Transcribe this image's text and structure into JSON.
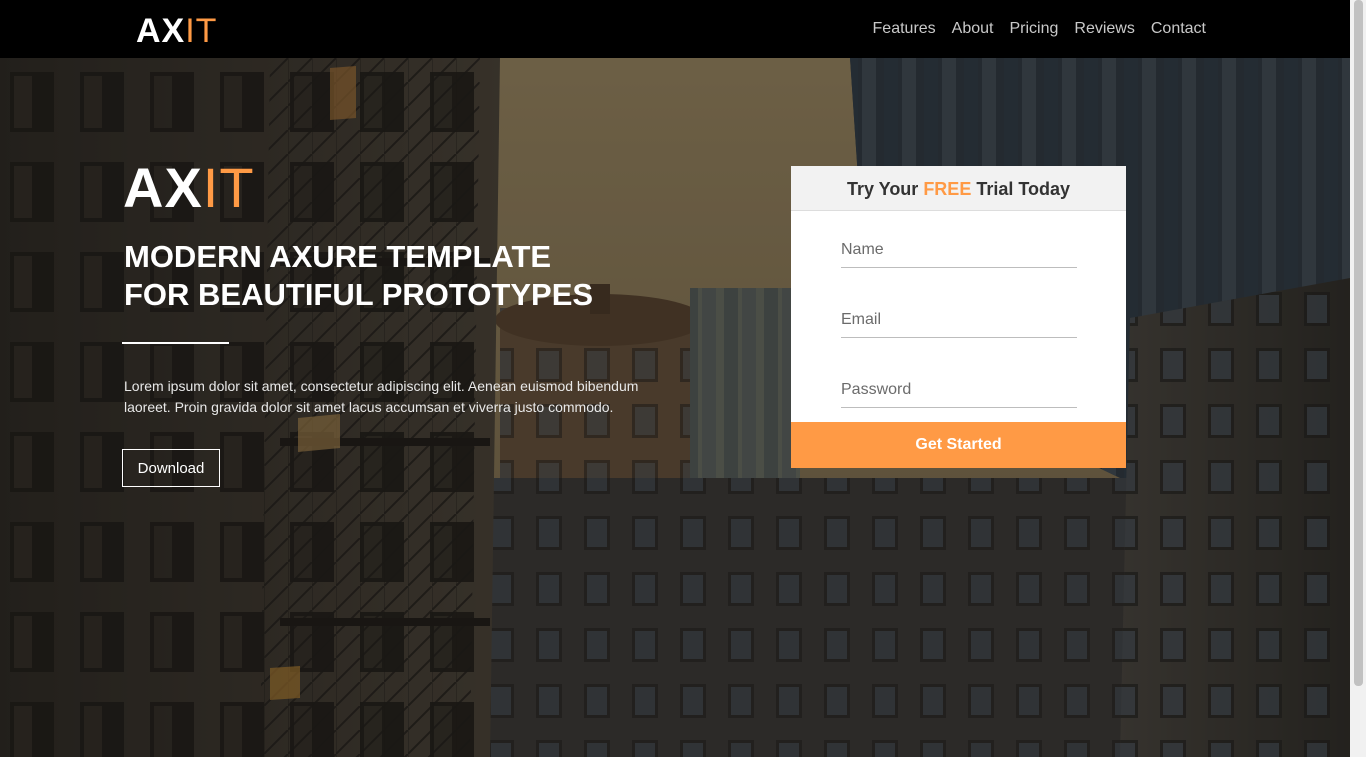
{
  "navbar": {
    "logo": {
      "part1": "AX",
      "part2": "IT"
    },
    "links": [
      "Features",
      "About",
      "Pricing",
      "Reviews",
      "Contact"
    ]
  },
  "hero": {
    "logo": {
      "part1": "AX",
      "part2": "IT"
    },
    "headline_line1": "MODERN AXURE TEMPLATE",
    "headline_line2": "FOR BEAUTIFUL PROTOTYPES",
    "description": "Lorem ipsum dolor sit amet, consectetur adipiscing elit. Aenean euismod bibendum laoreet. Proin gravida dolor sit amet lacus accumsan et viverra justo commodo.",
    "download_label": "Download"
  },
  "signup": {
    "title_prefix": "Try Your ",
    "title_highlight": "FREE",
    "title_suffix": " Trial Today",
    "name_placeholder": "Name",
    "email_placeholder": "Email",
    "password_placeholder": "Password",
    "submit_label": "Get Started"
  },
  "colors": {
    "accent": "#ff9a45",
    "navbar_bg": "#000000",
    "form_header_bg": "#f2f2f2"
  }
}
